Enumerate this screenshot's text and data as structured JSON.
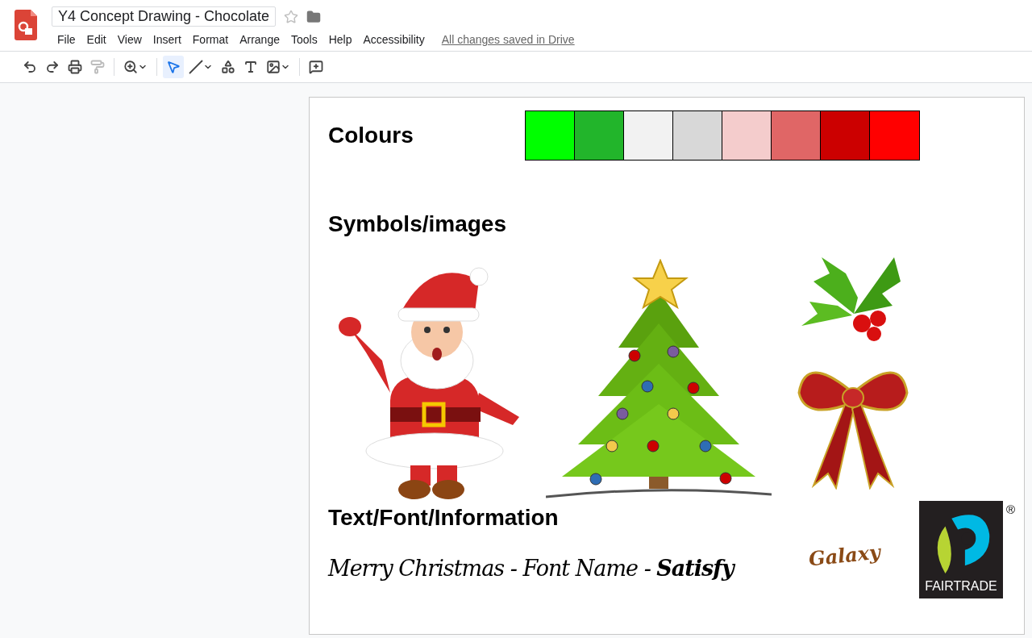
{
  "app": {
    "title": "Y4 Concept Drawing - Chocolate",
    "starred": false,
    "menu": [
      "File",
      "Edit",
      "View",
      "Insert",
      "Format",
      "Arrange",
      "Tools",
      "Help",
      "Accessibility"
    ],
    "save_status": "All changes saved in Drive"
  },
  "toolbar": [
    {
      "kind": "undo",
      "selected": false,
      "disabled": false
    },
    {
      "kind": "redo",
      "selected": false,
      "disabled": false
    },
    {
      "kind": "print",
      "selected": false,
      "disabled": false
    },
    {
      "kind": "paint",
      "selected": false,
      "disabled": true
    },
    {
      "kind": "sep"
    },
    {
      "kind": "zoom",
      "selected": false,
      "disabled": false
    },
    {
      "kind": "sep"
    },
    {
      "kind": "select",
      "selected": true,
      "disabled": false
    },
    {
      "kind": "line",
      "selected": false,
      "disabled": false
    },
    {
      "kind": "shape",
      "selected": false,
      "disabled": false
    },
    {
      "kind": "textbox",
      "selected": false,
      "disabled": false
    },
    {
      "kind": "image",
      "selected": false,
      "disabled": false
    },
    {
      "kind": "sep"
    },
    {
      "kind": "comment",
      "selected": false,
      "disabled": false
    }
  ],
  "slide": {
    "colours": {
      "heading": "Colours",
      "swatches": [
        {
          "color": "#00ff00"
        },
        {
          "color": "#22b52b"
        },
        {
          "color": "#f2f2f2"
        },
        {
          "color": "#d8d8d8"
        },
        {
          "color": "#f4cccc"
        },
        {
          "color": "#e06666"
        },
        {
          "color": "#cc0000"
        },
        {
          "color": "#ff0000"
        }
      ]
    },
    "symbols": {
      "heading": "Symbols/images"
    },
    "text": {
      "heading": "Text/Font/Information",
      "sample": "Merry Christmas - Font Name - **Satisfy**",
      "logos": [
        {
          "kind": "galaxy",
          "label": "Galaxy"
        },
        {
          "kind": "fairtrade",
          "label": "FAIRTRADE",
          "mark": "®"
        }
      ]
    }
  }
}
